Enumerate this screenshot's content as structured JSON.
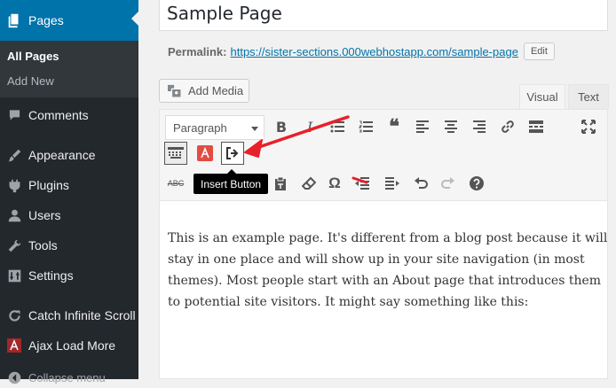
{
  "sidebar": {
    "current": {
      "label": "Pages"
    },
    "submenu": [
      {
        "label": "All Pages",
        "active": true
      },
      {
        "label": "Add New",
        "active": false
      }
    ],
    "items": [
      {
        "label": "Comments"
      },
      {
        "label": "Appearance"
      },
      {
        "label": "Plugins"
      },
      {
        "label": "Users"
      },
      {
        "label": "Tools"
      },
      {
        "label": "Settings"
      },
      {
        "label": "Catch Infinite Scroll"
      },
      {
        "label": "Ajax Load More"
      },
      {
        "label": "Collapse menu"
      }
    ]
  },
  "editor": {
    "title": "Sample Page",
    "permalink_label": "Permalink:",
    "permalink_url": "https://sister-sections.000webhostapp.com/sample-page",
    "edit_label": "Edit",
    "add_media_label": "Add Media",
    "tabs": {
      "visual": "Visual",
      "text": "Text"
    },
    "format_select": "Paragraph",
    "tooltip": "Insert Button",
    "content": "This is an example page. It's different from a blog post because it will stay in one place and will show up in your site navigation (in most themes). Most people start with an About page that introduces them to potential site visitors. It might say something like this:"
  },
  "colors": {
    "admin_bar": "#23282d",
    "accent": "#0073aa",
    "annotation": "#e8202a"
  }
}
